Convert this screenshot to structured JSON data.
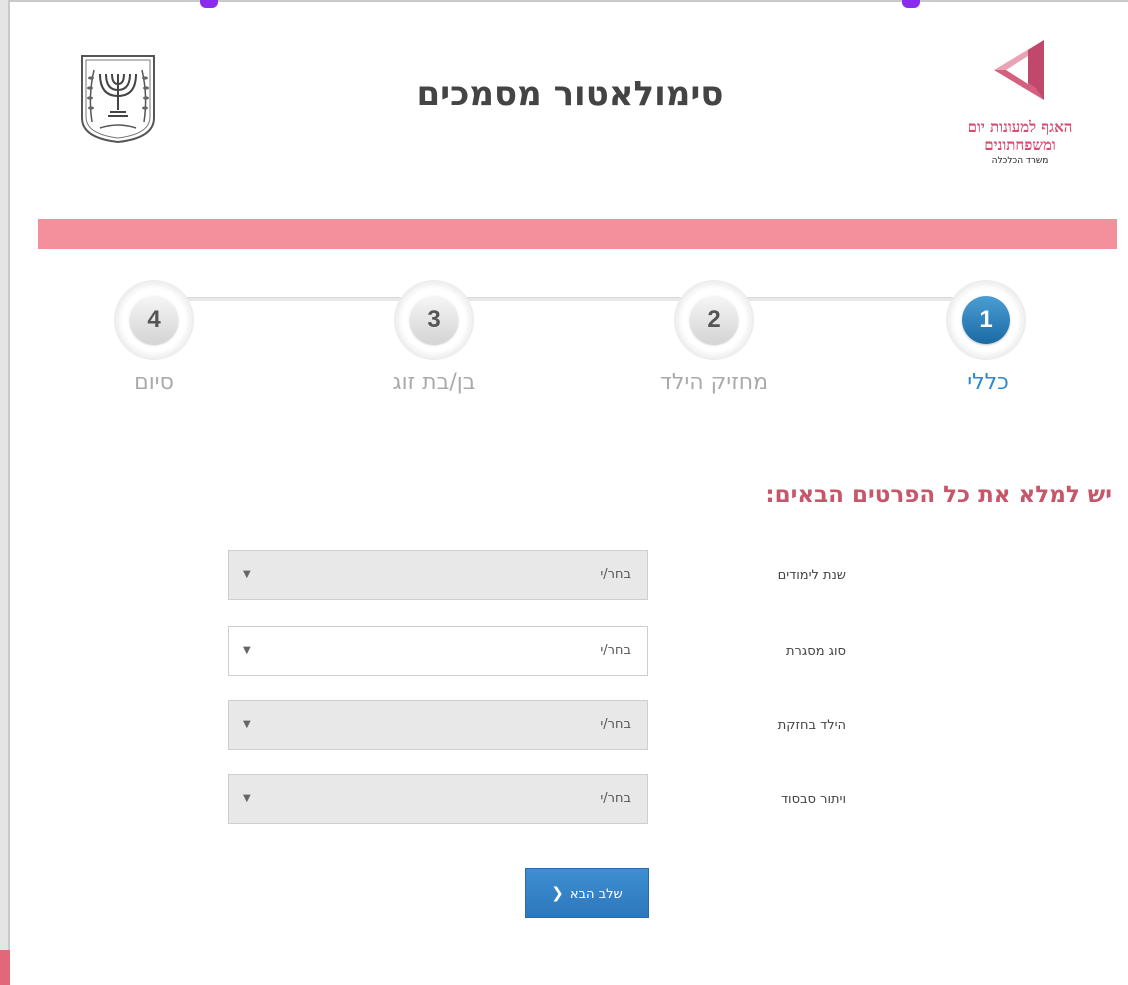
{
  "header": {
    "title": "סימולאטור מסמכים",
    "logo": {
      "line1": "האגף למעונות יום",
      "line2": "ומשפחתונים",
      "line3": "משרד הכלכלה"
    },
    "emblem_icon": "israel-emblem-icon"
  },
  "colors": {
    "brand_pink": "#f48f9c",
    "heading_pink": "#c8566a",
    "active_blue": "#2a8ad0",
    "button_blue": "#3f8fd2"
  },
  "steps": [
    {
      "number": "1",
      "label": "כללי",
      "active": true
    },
    {
      "number": "2",
      "label": "מחזיק הילד",
      "active": false
    },
    {
      "number": "3",
      "label": "בן/בת זוג",
      "active": false
    },
    {
      "number": "4",
      "label": "סיום",
      "active": false
    }
  ],
  "form": {
    "heading": "יש למלא את כל הפרטים הבאים:",
    "fields": [
      {
        "label": "שנת לימודים",
        "value": "בחר/י"
      },
      {
        "label": "סוג מסגרת",
        "value": "בחר/י"
      },
      {
        "label": "הילד בחזקת",
        "value": "בחר/י"
      },
      {
        "label": "ויתור סבסוד",
        "value": "בחר/י"
      }
    ],
    "next_button": "שלב הבא"
  }
}
